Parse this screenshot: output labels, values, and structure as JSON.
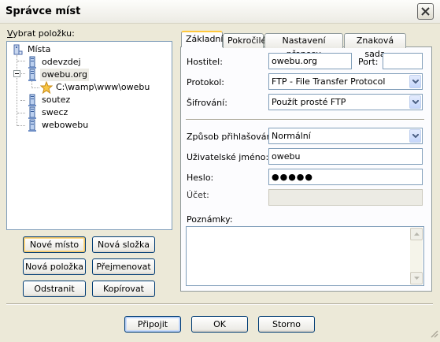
{
  "window": {
    "title": "Správce míst",
    "close_icon": "close-icon"
  },
  "tree": {
    "label_underline": "V",
    "label_rest": "ybrat položku:",
    "root": {
      "label": "Místa",
      "icon": "computer-icon"
    },
    "items": [
      {
        "label": "odevzdej",
        "icon": "server-icon",
        "selected": false
      },
      {
        "label": "owebu.org",
        "icon": "server-icon",
        "selected": true,
        "expanded": true
      },
      {
        "label": "C:\\wamp\\www\\owebu",
        "icon": "bookmark-star-icon",
        "selected": false
      },
      {
        "label": "soutez",
        "icon": "server-icon",
        "selected": false
      },
      {
        "label": "swecz",
        "icon": "server-icon",
        "selected": false
      },
      {
        "label": "webowebu",
        "icon": "server-icon",
        "selected": false
      }
    ]
  },
  "left_buttons": {
    "new_site": "Nové místo",
    "new_folder": "Nová složka",
    "new_bookmark": "Nová položka",
    "rename": "Přejmenovat",
    "delete": "Odstranit",
    "copy": "Kopírovat"
  },
  "tabs": [
    {
      "label": "Základní",
      "active": true
    },
    {
      "label": "Pokročilé",
      "active": false
    },
    {
      "label": "Nastavení přenosu",
      "active": false
    },
    {
      "label": "Znaková sada",
      "active": false
    }
  ],
  "form": {
    "host_label": "Hostitel:",
    "host_value": "owebu.org",
    "port_label": "Port:",
    "port_value": "",
    "protocol_label": "Protokol:",
    "protocol_value": "FTP - File Transfer Protocol",
    "encryption_label": "Šifrování:",
    "encryption_value": "Použít prosté FTP",
    "logon_label": "Způsob přihlašování:",
    "logon_value": "Normální",
    "user_label": "Uživatelské jméno:",
    "user_value": "owebu",
    "password_label": "Heslo:",
    "password_value": "●●●●●",
    "account_label": "Účet:",
    "account_value": "",
    "notes_label": "Poznámky:",
    "notes_value": ""
  },
  "bottom_buttons": {
    "connect": "Připojit",
    "ok": "OK",
    "cancel": "Storno"
  }
}
